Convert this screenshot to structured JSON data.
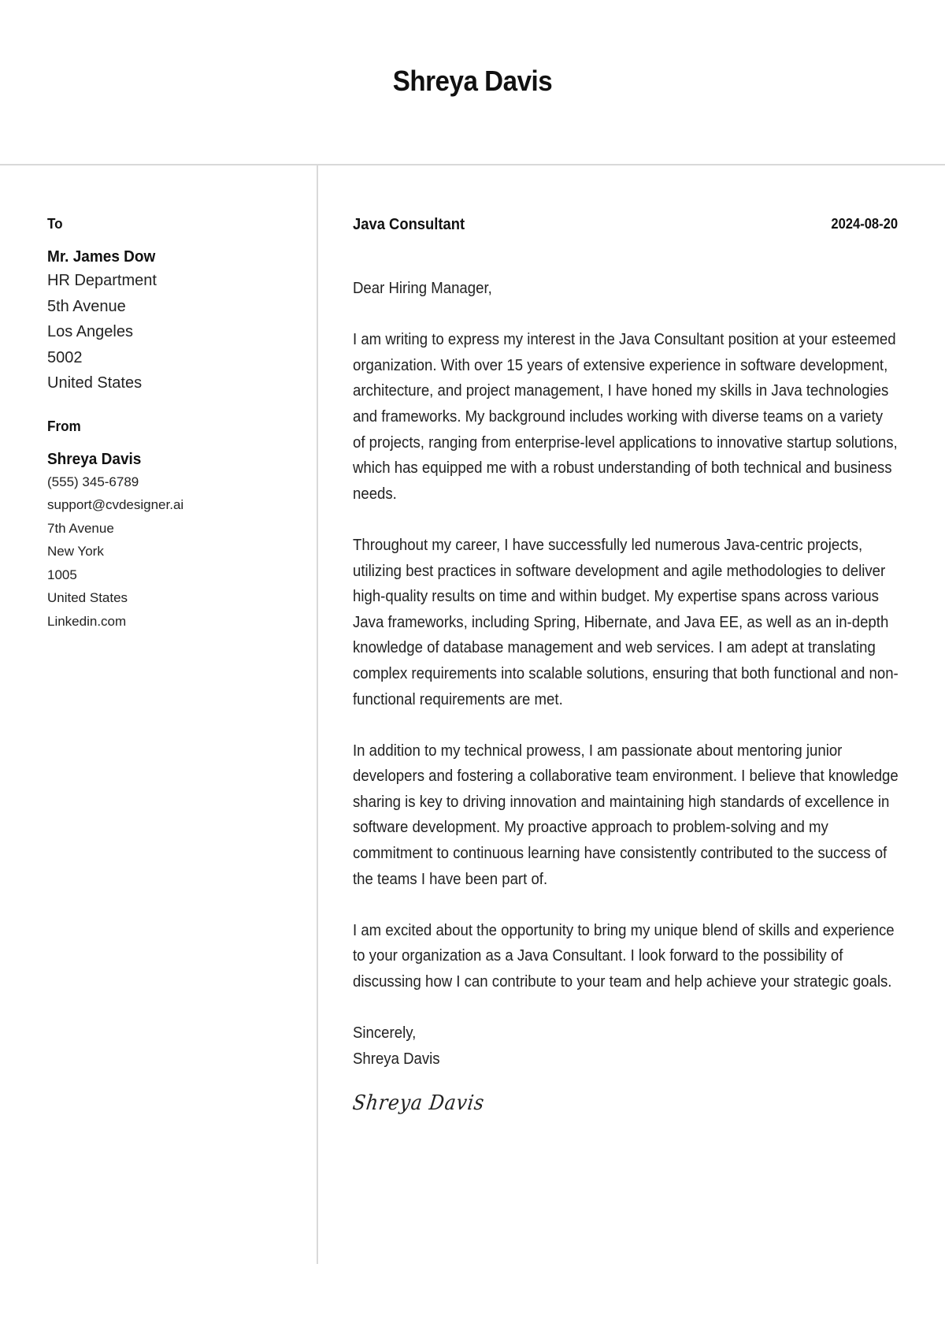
{
  "header": {
    "name": "Shreya Davis"
  },
  "recipient": {
    "label": "To",
    "name": "Mr. James Dow",
    "address_lines": [
      "HR Department",
      "5th Avenue",
      "Los Angeles",
      "5002",
      "United States"
    ]
  },
  "sender": {
    "label": "From",
    "name": "Shreya Davis",
    "phone": "(555) 345-6789",
    "email": "support@cvdesigner.ai",
    "street": "7th Avenue",
    "city": "New York",
    "postal_code": "1005",
    "country": "United States",
    "website": "Linkedin.com"
  },
  "letter": {
    "job_title": "Java Consultant",
    "date": "2024-08-20",
    "salutation": "Dear Hiring Manager,",
    "paragraphs": [
      "I am writing to express my interest in the Java Consultant position at your esteemed organization. With over 15 years of extensive experience in software development, architecture, and project management, I have honed my skills in Java technologies and frameworks. My background includes working with diverse teams on a variety of projects, ranging from enterprise-level applications to innovative startup solutions, which has equipped me with a robust understanding of both technical and business needs.",
      "Throughout my career, I have successfully led numerous Java-centric projects, utilizing best practices in software development and agile methodologies to deliver high-quality results on time and within budget. My expertise spans across various Java frameworks, including Spring, Hibernate, and Java EE, as well as an in-depth knowledge of database management and web services. I am adept at translating complex requirements into scalable solutions, ensuring that both functional and non-functional requirements are met.",
      "In addition to my technical prowess, I am passionate about mentoring junior developers and fostering a collaborative team environment. I believe that knowledge sharing is key to driving innovation and maintaining high standards of excellence in software development. My proactive approach to problem-solving and my commitment to continuous learning have consistently contributed to the success of the teams I have been part of.",
      "I am excited about the opportunity to bring my unique blend of skills and experience to your organization as a Java Consultant. I look forward to the possibility of discussing how I can contribute to your team and help achieve your strategic goals."
    ],
    "closing": "Sincerely,",
    "closing_name": "Shreya Davis",
    "signature": "Shreya Davis"
  }
}
